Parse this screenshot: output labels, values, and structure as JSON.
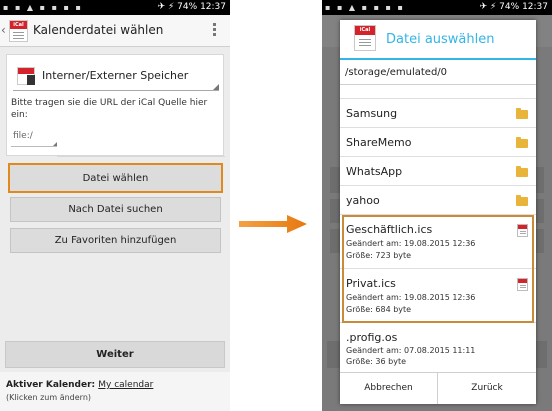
{
  "status_bar": {
    "battery": "74%",
    "time": "12:37"
  },
  "app_bar": {
    "title": "Kalenderdatei wählen"
  },
  "source": {
    "storage_label": "Interner/Externer Speicher",
    "url_prompt": "Bitte tragen sie die URL der iCal Quelle hier ein:",
    "url_value": "file:/"
  },
  "buttons": {
    "choose_file": "Datei wählen",
    "search_file": "Nach Datei suchen",
    "favorites": "Zu Favoriten hinzufügen",
    "next": "Weiter"
  },
  "footer": {
    "active_calendar_label": "Aktiver Kalender:",
    "active_calendar_value": "My calendar",
    "hint": "(Klicken zum ändern)"
  },
  "dialog": {
    "title": "Datei auswählen",
    "path": "/storage/emulated/0",
    "folders": [
      {
        "name": "Samsung"
      },
      {
        "name": "ShareMemo"
      },
      {
        "name": "WhatsApp"
      },
      {
        "name": "yahoo"
      }
    ],
    "files": [
      {
        "name": "Geschäftlich.ics",
        "changed": "Geändert am: 19.08.2015 12:36",
        "size": "Größe: 723 byte"
      },
      {
        "name": "Privat.ics",
        "changed": "Geändert am: 19.08.2015 12:36",
        "size": "Größe: 684 byte"
      },
      {
        "name": ".profig.os",
        "changed": "Geändert am: 07.08.2015 11:11",
        "size": "Größe: 36 byte"
      }
    ],
    "cancel": "Abbrechen",
    "back": "Zurück"
  },
  "colors": {
    "highlight": "#e08a1e",
    "arrow": "#f08a1c",
    "dialog_accent": "#33b5e5",
    "ical_red": "#d4232a",
    "folder": "#e8b43a"
  }
}
